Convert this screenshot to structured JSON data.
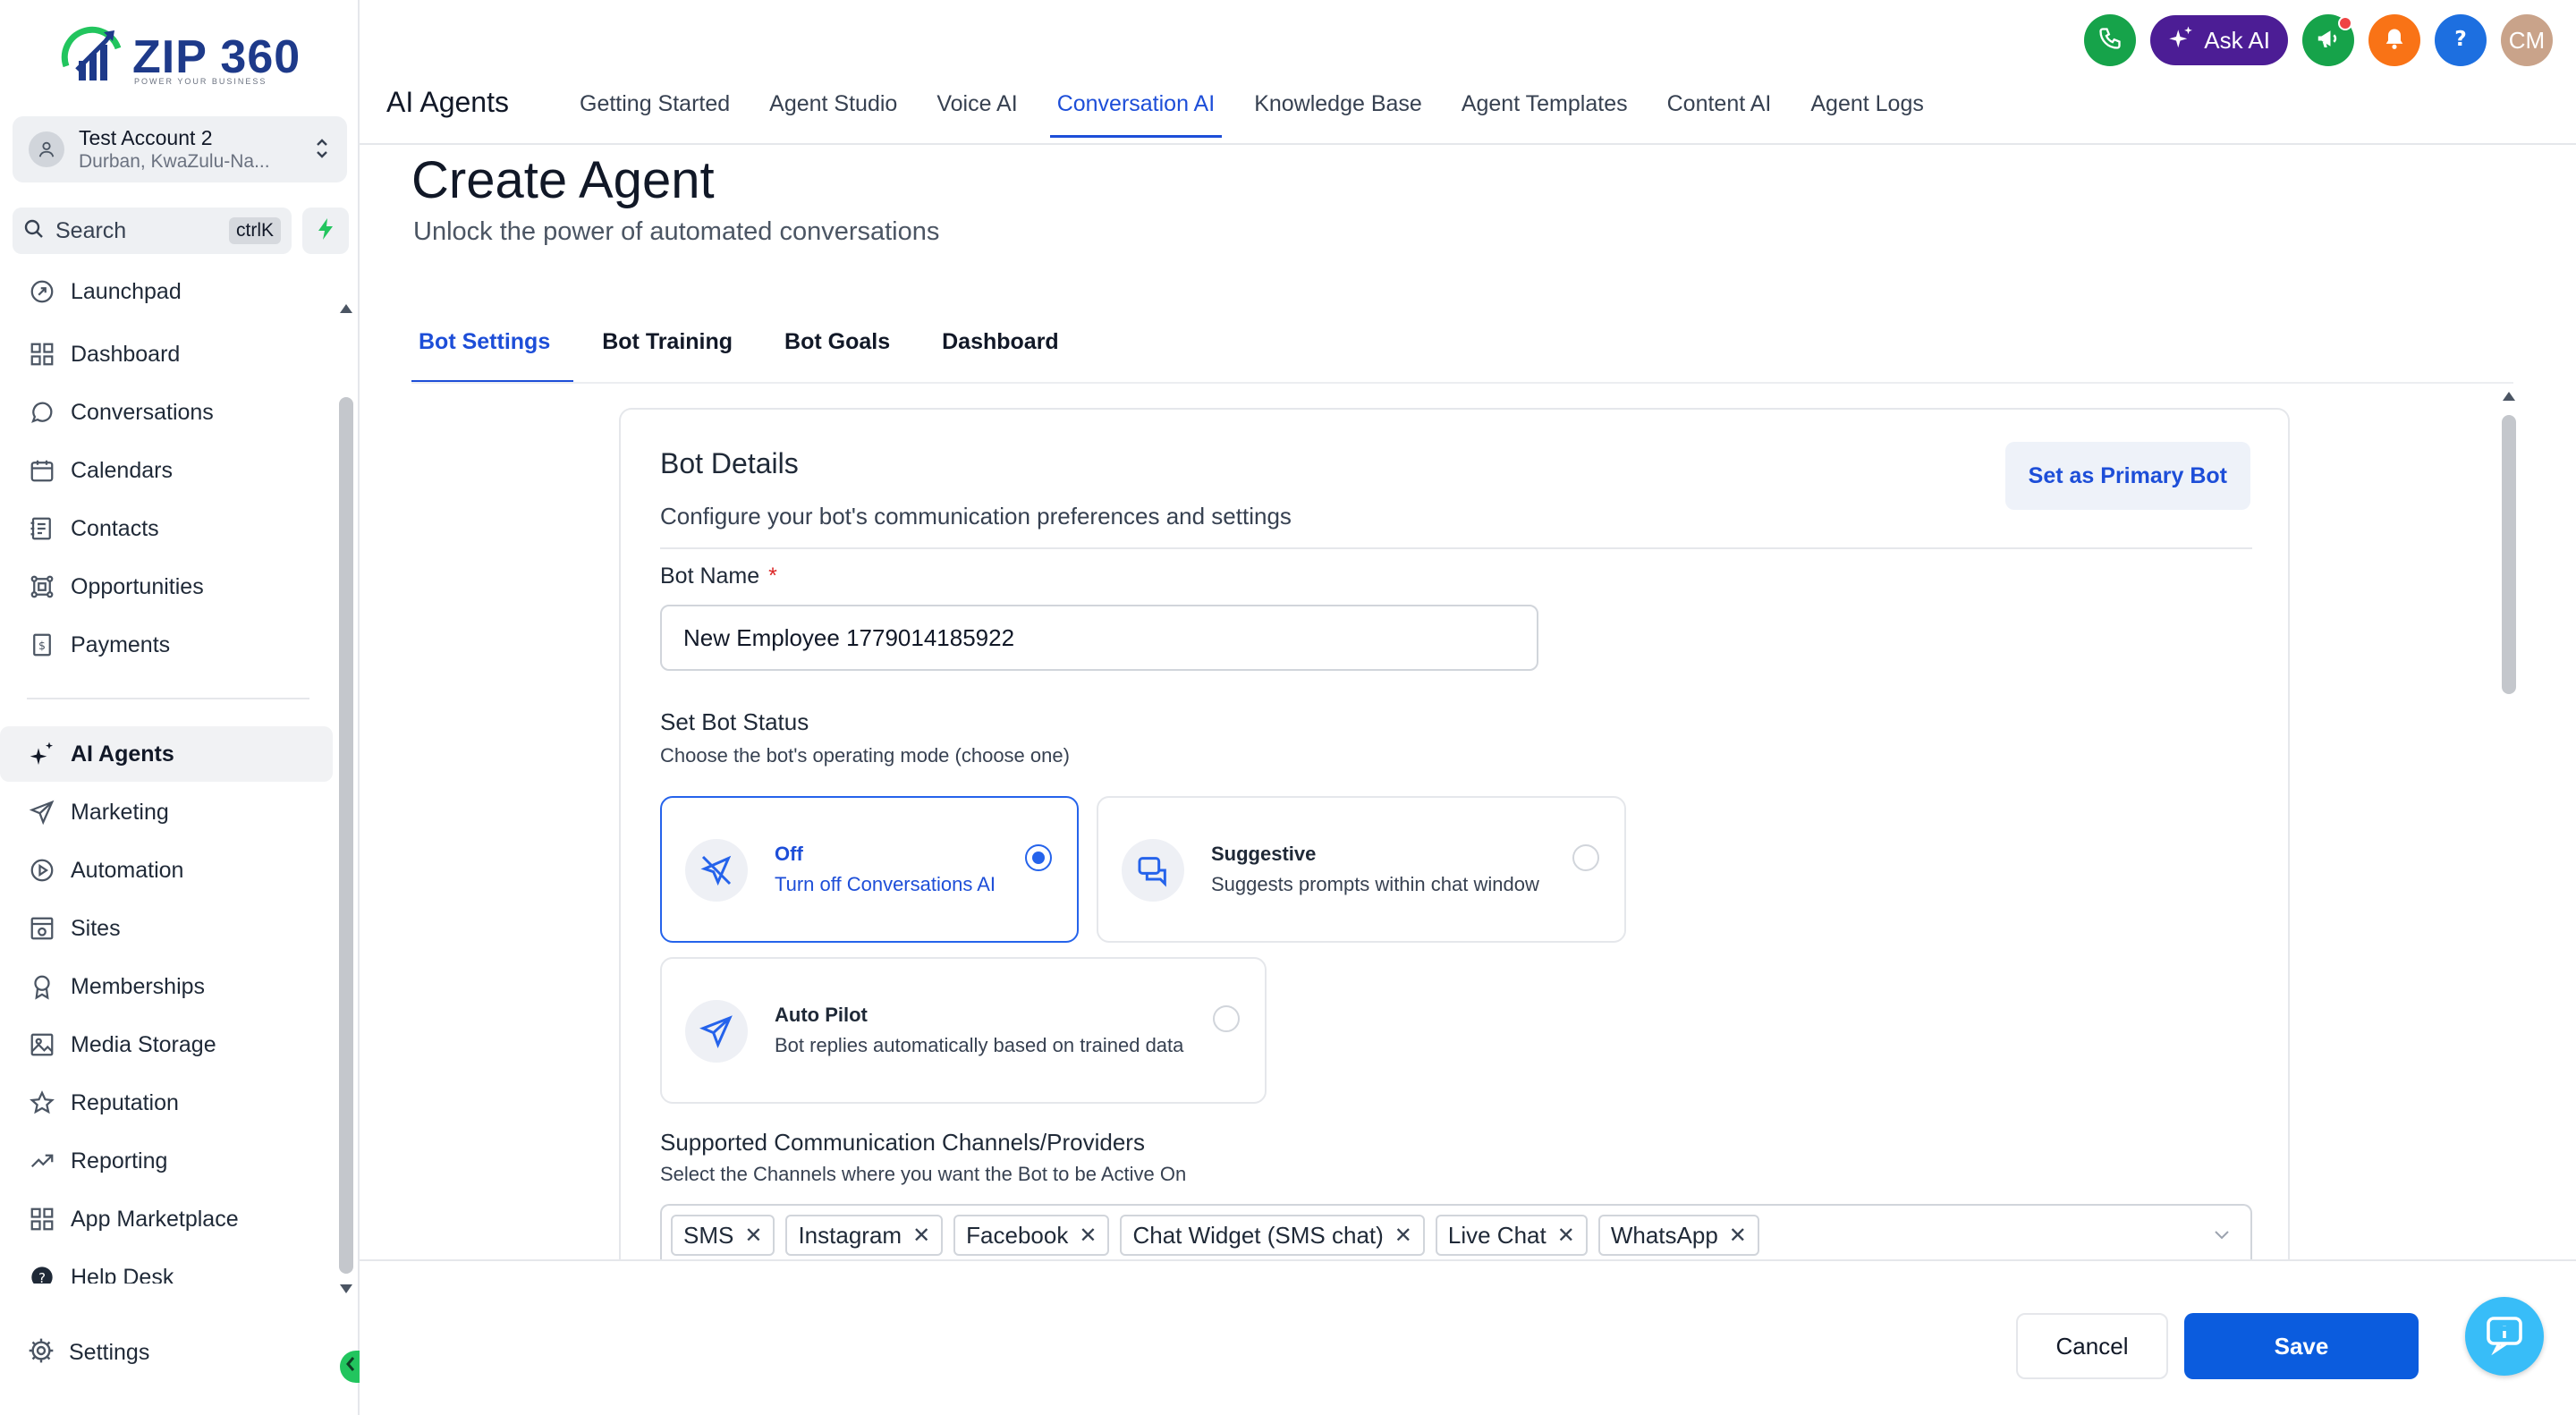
{
  "brand": {
    "name": "ZIP 360",
    "tagline": "POWER YOUR BUSINESS",
    "accent": "#1d4ed8"
  },
  "account": {
    "name": "Test Account 2",
    "location": "Durban, KwaZulu-Na..."
  },
  "search": {
    "label": "Search",
    "shortcut": "ctrlK"
  },
  "sidebar": {
    "items": [
      {
        "label": "Launchpad",
        "icon": "rocket-icon"
      },
      {
        "label": "Dashboard",
        "icon": "grid-icon"
      },
      {
        "label": "Conversations",
        "icon": "chat-icon"
      },
      {
        "label": "Calendars",
        "icon": "calendar-icon"
      },
      {
        "label": "Contacts",
        "icon": "contacts-icon"
      },
      {
        "label": "Opportunities",
        "icon": "funnel-icon"
      },
      {
        "label": "Payments",
        "icon": "payments-icon"
      },
      {
        "label": "AI Agents",
        "icon": "sparkle-icon"
      },
      {
        "label": "Marketing",
        "icon": "send-icon"
      },
      {
        "label": "Automation",
        "icon": "automation-icon"
      },
      {
        "label": "Sites",
        "icon": "sites-icon"
      },
      {
        "label": "Memberships",
        "icon": "badge-icon"
      },
      {
        "label": "Media Storage",
        "icon": "image-icon"
      },
      {
        "label": "Reputation",
        "icon": "star-icon"
      },
      {
        "label": "Reporting",
        "icon": "trend-icon"
      },
      {
        "label": "App Marketplace",
        "icon": "apps-icon"
      },
      {
        "label": "Help Desk",
        "icon": "help-icon"
      }
    ],
    "settings_label": "Settings"
  },
  "header": {
    "title": "AI Agents",
    "tabs": [
      {
        "label": "Getting Started"
      },
      {
        "label": "Agent Studio"
      },
      {
        "label": "Voice AI"
      },
      {
        "label": "Conversation AI"
      },
      {
        "label": "Knowledge Base"
      },
      {
        "label": "Agent Templates"
      },
      {
        "label": "Content AI"
      },
      {
        "label": "Agent Logs"
      }
    ],
    "ask_ai_label": "Ask AI",
    "avatar_initials": "CM"
  },
  "page": {
    "title": "Create Agent",
    "subtitle": "Unlock the power of automated conversations",
    "tabs": [
      {
        "label": "Bot Settings"
      },
      {
        "label": "Bot Training"
      },
      {
        "label": "Bot Goals"
      },
      {
        "label": "Dashboard"
      }
    ]
  },
  "bot_details": {
    "title": "Bot Details",
    "description": "Configure your bot's communication preferences and settings",
    "primary_button": "Set as Primary Bot",
    "bot_name_label": "Bot Name",
    "bot_name_required": "*",
    "bot_name_value": "New Employee 1779014185922",
    "status_title": "Set Bot Status",
    "status_subtitle": "Choose the bot's operating mode (choose one)",
    "modes": [
      {
        "title": "Off",
        "desc": "Turn off Conversations AI",
        "selected": true
      },
      {
        "title": "Suggestive",
        "desc": "Suggests prompts within chat window",
        "selected": false
      },
      {
        "title": "Auto Pilot",
        "desc": "Bot replies automatically based on trained data",
        "selected": false
      }
    ],
    "channels_title": "Supported Communication Channels/Providers",
    "channels_subtitle": "Select the Channels where you want the Bot to be Active On",
    "channels": [
      {
        "label": "SMS"
      },
      {
        "label": "Instagram"
      },
      {
        "label": "Facebook"
      },
      {
        "label": "Chat Widget (SMS chat)"
      },
      {
        "label": "Live Chat"
      },
      {
        "label": "WhatsApp"
      }
    ]
  },
  "footer": {
    "cancel": "Cancel",
    "save": "Save"
  }
}
